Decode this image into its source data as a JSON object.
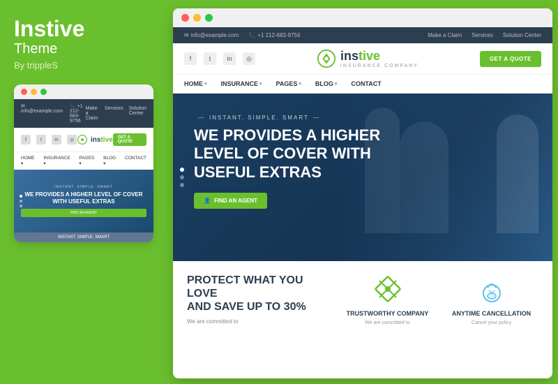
{
  "left": {
    "title": "Instive",
    "subtitle": "Theme",
    "by": "By trippleS"
  },
  "mini": {
    "topbar": {
      "email": "info@example.com",
      "phone": "+1 212-683-9756",
      "links": [
        "Make a Claim",
        "Services",
        "Solution Center"
      ]
    },
    "logo": "instive",
    "quote_btn": "GET A QUOTE",
    "menu": [
      "HOME",
      "INSURANCE",
      "PAGES",
      "BLOG",
      "CONTACT"
    ],
    "hero": {
      "tagline": "INSTANT. SIMPLE. SMART",
      "headline": "WE PROVIDES A HIGHER LEVEL OF COVER WITH USEFUL EXTRAS",
      "cta": "FIND AN AGENT",
      "bottom_tag": "INSTANT. SIMPLE. SMART"
    }
  },
  "header": {
    "email": "info@example.com",
    "phone": "+1 212-683-9756",
    "links": [
      "Make a Claim",
      "Services",
      "Solution Center"
    ],
    "logo_text": "instive",
    "logo_sub": "INSURANCE COMPANY",
    "quote_btn": "GET A QUOTE"
  },
  "nav": {
    "items": [
      "HOME",
      "INSURANCE",
      "PAGES",
      "BLOG",
      "CONTACT"
    ]
  },
  "hero": {
    "tagline": "INSTANT. SIMPLE. SMART",
    "headline_line1": "WE PROVIDES A HIGHER",
    "headline_line2": "LEVEL OF COVER WITH",
    "headline_line3": "USEFUL EXTRAS",
    "cta": "FIND AN AGENT"
  },
  "bottom": {
    "heading_line1": "PROTECT WHAT YOU LOVE",
    "heading_line2": "AND SAVE UP TO 30%",
    "desc": "We are committed to",
    "features": [
      {
        "title": "TRUSTWORTHY COMPANY",
        "desc": "We are committed to"
      },
      {
        "title": "ANYTIME CANCELLATION",
        "desc": "Cancel your policy"
      }
    ]
  },
  "social": {
    "icons": [
      "f",
      "t",
      "in",
      "cam"
    ]
  }
}
